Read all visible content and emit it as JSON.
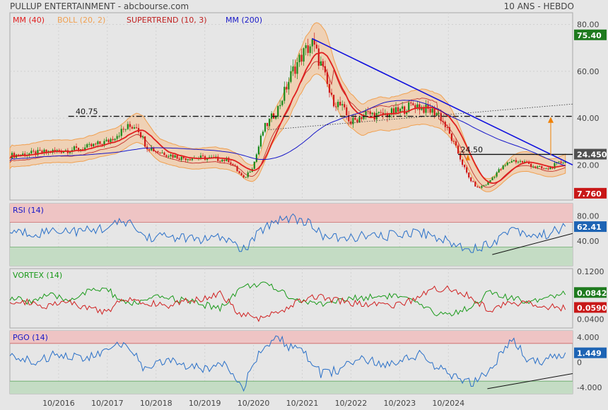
{
  "header": {
    "title": "PULLUP ENTERTAINMENT - abcbourse.com",
    "period": "10 ANS - HEBDO"
  },
  "colors": {
    "ma40": "#e02020",
    "bollinger": "#f0a050",
    "supertrend": "#c02020",
    "ma200": "#1818c8",
    "up": "#1a8a1a",
    "down": "#d01818",
    "trendline": "#1010dd",
    "rsi_line": "#2a70c8",
    "vortex_plus": "#1a9a1a",
    "vortex_minus": "#d02020",
    "overbought_zone": "#eec4c4",
    "oversold_zone": "#c4dcc4"
  },
  "chart_data": [
    {
      "panel": "price",
      "type": "candlestick",
      "legend": [
        {
          "label": "MM (40)",
          "color": "#e02020"
        },
        {
          "label": "BOLL (20, 2)",
          "color": "#f0a050"
        },
        {
          "label": "SUPERTREND (10, 3)",
          "color": "#c02020"
        },
        {
          "label": "MM (200)",
          "color": "#1818c8"
        }
      ],
      "x_ticks": [
        "10/2016",
        "10/2017",
        "10/2018",
        "10/2019",
        "10/2020",
        "10/2021",
        "10/2022",
        "10/2023",
        "10/2024"
      ],
      "y_ticks": [
        20,
        40,
        60,
        80
      ],
      "y_tick_labels": [
        "20.00",
        "40.00",
        "60.00",
        "80.00"
      ],
      "ylim": [
        5,
        85
      ],
      "price_series_approx": [
        {
          "x": 0.0,
          "y": 24
        },
        {
          "x": 0.5,
          "y": 25
        },
        {
          "x": 1.0,
          "y": 26
        },
        {
          "x": 1.5,
          "y": 27
        },
        {
          "x": 2.0,
          "y": 30
        },
        {
          "x": 2.4,
          "y": 36
        },
        {
          "x": 2.6,
          "y": 37
        },
        {
          "x": 2.8,
          "y": 28
        },
        {
          "x": 3.0,
          "y": 26
        },
        {
          "x": 3.5,
          "y": 23
        },
        {
          "x": 4.0,
          "y": 23
        },
        {
          "x": 4.5,
          "y": 22
        },
        {
          "x": 4.8,
          "y": 14
        },
        {
          "x": 5.0,
          "y": 20
        },
        {
          "x": 5.2,
          "y": 35
        },
        {
          "x": 5.5,
          "y": 44
        },
        {
          "x": 5.8,
          "y": 60
        },
        {
          "x": 6.0,
          "y": 67
        },
        {
          "x": 6.2,
          "y": 72
        },
        {
          "x": 6.4,
          "y": 62
        },
        {
          "x": 6.6,
          "y": 48
        },
        {
          "x": 6.8,
          "y": 45
        },
        {
          "x": 7.0,
          "y": 38
        },
        {
          "x": 7.3,
          "y": 42
        },
        {
          "x": 7.6,
          "y": 41
        },
        {
          "x": 8.0,
          "y": 43
        },
        {
          "x": 8.3,
          "y": 46
        },
        {
          "x": 8.5,
          "y": 44
        },
        {
          "x": 8.8,
          "y": 42
        },
        {
          "x": 9.0,
          "y": 34
        },
        {
          "x": 9.2,
          "y": 25
        },
        {
          "x": 9.4,
          "y": 15
        },
        {
          "x": 9.6,
          "y": 10
        },
        {
          "x": 9.8,
          "y": 12
        },
        {
          "x": 10.0,
          "y": 17
        },
        {
          "x": 10.3,
          "y": 22
        },
        {
          "x": 10.6,
          "y": 21
        },
        {
          "x": 10.8,
          "y": 19
        },
        {
          "x": 11.0,
          "y": 18
        },
        {
          "x": 11.2,
          "y": 20
        },
        {
          "x": 11.4,
          "y": 22
        }
      ],
      "levels": [
        {
          "value": 40.75,
          "label": "40.75",
          "style": "dash-dot"
        },
        {
          "value": 24.5,
          "label": "24.50",
          "style": "solid"
        }
      ],
      "last_values": [
        {
          "label": "75.40",
          "value": 75.4,
          "color": "#1e7a1e"
        },
        {
          "label": "24.450",
          "value": 24.45,
          "color": "#505050"
        },
        {
          "label": "7.760",
          "value": 7.76,
          "color": "#c81818"
        }
      ]
    },
    {
      "panel": "rsi",
      "type": "line",
      "legend": [
        {
          "label": "RSI (14)",
          "color": "#1818c8"
        }
      ],
      "y_ticks": [
        40,
        80
      ],
      "y_tick_labels": [
        "40.00",
        "80.00"
      ],
      "ylim": [
        0,
        100
      ],
      "zones": {
        "overbought": 70,
        "oversold": 30
      },
      "series_approx": [
        {
          "x": 0.0,
          "y": 55
        },
        {
          "x": 0.5,
          "y": 52
        },
        {
          "x": 1.0,
          "y": 58
        },
        {
          "x": 1.5,
          "y": 55
        },
        {
          "x": 2.0,
          "y": 62
        },
        {
          "x": 2.4,
          "y": 72
        },
        {
          "x": 2.8,
          "y": 45
        },
        {
          "x": 3.2,
          "y": 48
        },
        {
          "x": 3.6,
          "y": 44
        },
        {
          "x": 4.0,
          "y": 42
        },
        {
          "x": 4.4,
          "y": 45
        },
        {
          "x": 4.8,
          "y": 25
        },
        {
          "x": 5.2,
          "y": 60
        },
        {
          "x": 5.5,
          "y": 75
        },
        {
          "x": 5.8,
          "y": 78
        },
        {
          "x": 6.1,
          "y": 70
        },
        {
          "x": 6.4,
          "y": 50
        },
        {
          "x": 6.8,
          "y": 42
        },
        {
          "x": 7.2,
          "y": 48
        },
        {
          "x": 7.6,
          "y": 46
        },
        {
          "x": 8.0,
          "y": 52
        },
        {
          "x": 8.4,
          "y": 55
        },
        {
          "x": 8.8,
          "y": 45
        },
        {
          "x": 9.2,
          "y": 32
        },
        {
          "x": 9.6,
          "y": 28
        },
        {
          "x": 10.0,
          "y": 42
        },
        {
          "x": 10.3,
          "y": 62
        },
        {
          "x": 10.6,
          "y": 52
        },
        {
          "x": 10.9,
          "y": 48
        },
        {
          "x": 11.2,
          "y": 56
        },
        {
          "x": 11.4,
          "y": 62
        }
      ],
      "last_value": {
        "label": "62.41",
        "value": 62.41,
        "color": "#1e64b4"
      }
    },
    {
      "panel": "vortex",
      "type": "line",
      "legend": [
        {
          "label": "VORTEX (14)",
          "color": "#1a9a1a"
        }
      ],
      "y_ticks": [
        0.04,
        0.12
      ],
      "y_tick_labels": [
        "0.0400",
        "0.1200"
      ],
      "ylim": [
        0.025,
        0.125
      ],
      "series": [
        {
          "name": "VI+",
          "color": "#1a9a1a",
          "values_approx": [
            0.075,
            0.07,
            0.08,
            0.072,
            0.085,
            0.092,
            0.065,
            0.07,
            0.078,
            0.072,
            0.065,
            0.058,
            0.092,
            0.1,
            0.09,
            0.072,
            0.065,
            0.07,
            0.075,
            0.078,
            0.08,
            0.07,
            0.052,
            0.048,
            0.06,
            0.085,
            0.075,
            0.07,
            0.078,
            0.084
          ]
        },
        {
          "name": "VI-",
          "color": "#d02020",
          "values_approx": [
            0.065,
            0.07,
            0.062,
            0.068,
            0.058,
            0.052,
            0.075,
            0.07,
            0.062,
            0.068,
            0.075,
            0.085,
            0.048,
            0.042,
            0.05,
            0.068,
            0.078,
            0.072,
            0.066,
            0.064,
            0.062,
            0.072,
            0.09,
            0.092,
            0.08,
            0.055,
            0.065,
            0.07,
            0.062,
            0.059
          ]
        }
      ],
      "last_values": [
        {
          "label": "0.0842",
          "value": 0.0842,
          "color": "#1e7a1e"
        },
        {
          "label": "0.0590",
          "value": 0.059,
          "color": "#c81818"
        }
      ]
    },
    {
      "panel": "pgo",
      "type": "line",
      "legend": [
        {
          "label": "PGO (14)",
          "color": "#1818c8"
        }
      ],
      "y_ticks": [
        -4,
        0,
        4
      ],
      "y_tick_labels": [
        "-4.000",
        "0",
        "4.000"
      ],
      "ylim": [
        -5,
        5
      ],
      "zones": {
        "overbought": 3,
        "oversold": -3
      },
      "series_approx": [
        {
          "x": 0.0,
          "y": 1
        },
        {
          "x": 0.5,
          "y": 0
        },
        {
          "x": 1.0,
          "y": 1.5
        },
        {
          "x": 1.5,
          "y": 0.5
        },
        {
          "x": 2.0,
          "y": 1.8
        },
        {
          "x": 2.4,
          "y": 3.2
        },
        {
          "x": 2.8,
          "y": -1.5
        },
        {
          "x": 3.2,
          "y": 0.5
        },
        {
          "x": 3.6,
          "y": -0.5
        },
        {
          "x": 4.0,
          "y": -1.2
        },
        {
          "x": 4.4,
          "y": 0.2
        },
        {
          "x": 4.8,
          "y": -3.8
        },
        {
          "x": 5.2,
          "y": 2.5
        },
        {
          "x": 5.5,
          "y": 3.8
        },
        {
          "x": 5.8,
          "y": 2.2
        },
        {
          "x": 6.1,
          "y": 1
        },
        {
          "x": 6.4,
          "y": -2
        },
        {
          "x": 6.8,
          "y": -1
        },
        {
          "x": 7.2,
          "y": 0.8
        },
        {
          "x": 7.6,
          "y": -0.5
        },
        {
          "x": 8.0,
          "y": 0.5
        },
        {
          "x": 8.4,
          "y": 1.2
        },
        {
          "x": 8.8,
          "y": -1
        },
        {
          "x": 9.2,
          "y": -2.8
        },
        {
          "x": 9.6,
          "y": -3.2
        },
        {
          "x": 10.0,
          "y": 0.5
        },
        {
          "x": 10.3,
          "y": 3.5
        },
        {
          "x": 10.6,
          "y": 0.8
        },
        {
          "x": 10.9,
          "y": -0.2
        },
        {
          "x": 11.2,
          "y": 1.2
        },
        {
          "x": 11.4,
          "y": 1.45
        }
      ],
      "last_value": {
        "label": "1.449",
        "value": 1.449,
        "color": "#1e64b4"
      }
    }
  ]
}
